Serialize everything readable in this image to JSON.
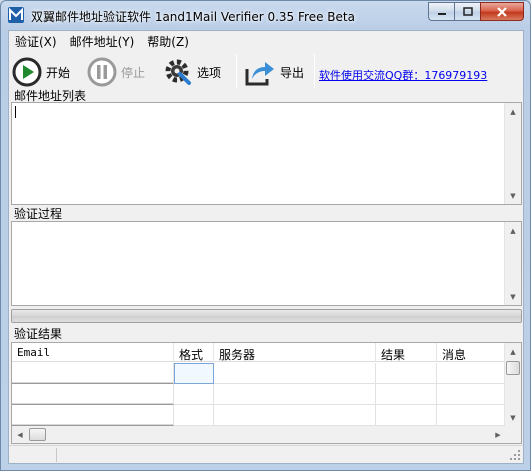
{
  "window": {
    "title": "双翼邮件地址验证软件 1and1Mail Verifier 0.35 Free Beta"
  },
  "menu": [
    {
      "label": "验证(X)"
    },
    {
      "label": "邮件地址(Y)"
    },
    {
      "label": "帮助(Z)"
    }
  ],
  "toolbar": {
    "start_label": "开始",
    "stop_label": "停止",
    "options_label": "选项",
    "export_label": "导出",
    "qq_link": "软件使用交流QQ群：176979193"
  },
  "sections": {
    "email_list_label": "邮件地址列表",
    "email_list_value": "",
    "process_label": "验证过程",
    "process_value": "",
    "results_label": "验证结果"
  },
  "progress": {
    "fraction": 0
  },
  "results": {
    "columns": [
      {
        "label": "Email"
      },
      {
        "label": "格式"
      },
      {
        "label": "服务器"
      },
      {
        "label": "结果"
      },
      {
        "label": "消息"
      }
    ]
  },
  "colors": {
    "accent": "#3a8fd6",
    "link": "#0000ee",
    "start_green": "#1f8a2e"
  },
  "icons": [
    "app-icon",
    "play-icon",
    "pause-icon",
    "gear-wrench-icon",
    "export-arrow-icon"
  ]
}
